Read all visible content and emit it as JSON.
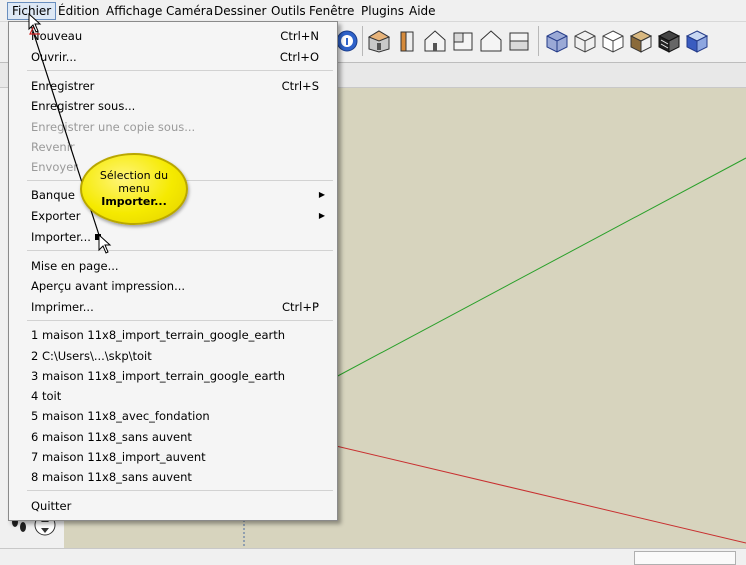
{
  "menubar": {
    "items": [
      "Fichier",
      "Édition",
      "Affichage",
      "Caméra",
      "Dessiner",
      "Outils",
      "Fenêtre",
      "Plugins",
      "Aide"
    ]
  },
  "menu": {
    "items": [
      {
        "label": "Nouveau",
        "shortcut": "Ctrl+N"
      },
      {
        "label": "Ouvrir...",
        "shortcut": "Ctrl+O"
      },
      {
        "label": "Enregistrer",
        "shortcut": "Ctrl+S"
      },
      {
        "label": "Enregistrer sous...",
        "shortcut": ""
      },
      {
        "label": "Enregistrer une copie sous...",
        "shortcut": ""
      },
      {
        "label": "Revenir",
        "shortcut": ""
      },
      {
        "label": "Envoyer",
        "shortcut": ""
      },
      {
        "label": "Banque",
        "shortcut": ""
      },
      {
        "label": "Exporter",
        "shortcut": ""
      },
      {
        "label": "Importer...",
        "shortcut": ""
      },
      {
        "label": "Mise en page...",
        "shortcut": ""
      },
      {
        "label": "Aperçu avant impression...",
        "shortcut": ""
      },
      {
        "label": "Imprimer...",
        "shortcut": "Ctrl+P"
      },
      {
        "label": "1 maison 11x8_import_terrain_google_earth",
        "shortcut": ""
      },
      {
        "label": "2 C:\\Users\\...\\skp\\toit",
        "shortcut": ""
      },
      {
        "label": "3 maison 11x8_import_terrain_google_earth",
        "shortcut": ""
      },
      {
        "label": "4 toit",
        "shortcut": ""
      },
      {
        "label": "5 maison 11x8_avec_fondation",
        "shortcut": ""
      },
      {
        "label": "6 maison 11x8_sans auvent",
        "shortcut": ""
      },
      {
        "label": "7 maison 11x8_import_auvent",
        "shortcut": ""
      },
      {
        "label": "8 maison 11x8_sans auvent",
        "shortcut": ""
      },
      {
        "label": "Quitter",
        "shortcut": ""
      }
    ]
  },
  "callout": {
    "line1": "Sélection du",
    "line2": "menu",
    "line3": "Importer..."
  },
  "colors": {
    "viewport": "#d7d4be",
    "callout": "#f5ea00",
    "axis_green": "#2aa02a",
    "axis_red": "#c83030"
  }
}
